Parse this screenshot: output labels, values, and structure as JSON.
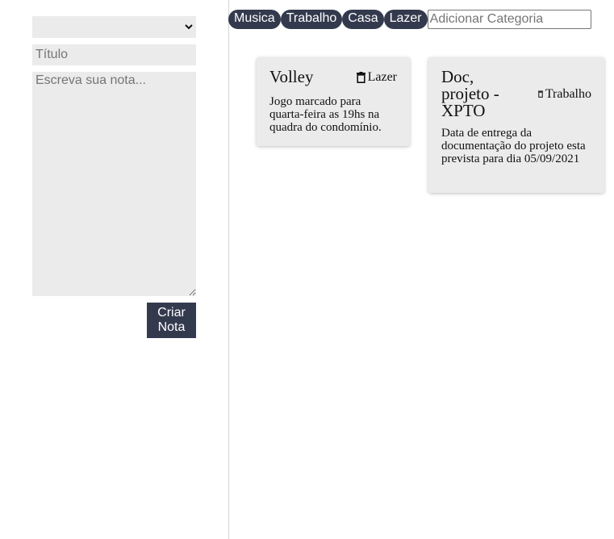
{
  "form": {
    "category_select_value": "",
    "title_placeholder": "Título",
    "note_placeholder": "Escreva sua nota...",
    "create_button_label": "Criar\nNota"
  },
  "categories": {
    "items": [
      "Musica",
      "Trabalho",
      "Casa",
      "Lazer"
    ],
    "add_placeholder": "Adicionar Categoria"
  },
  "notes": [
    {
      "title": "Volley",
      "category": "Lazer",
      "body": "Jogo marcado para quarta-feira as 19hs na quadra do condomínio."
    },
    {
      "title": "Doc, projeto - XPTO",
      "category": "Trabalho",
      "body": "Data de entrega da documentação do projeto esta prevista para dia 05/09/2021"
    }
  ],
  "colors": {
    "accent": "#343a4e",
    "field_background": "#ebebeb",
    "card_background": "#ebebeb"
  },
  "icons": {
    "delete": "trash-icon",
    "select": "chevron-down-icon"
  }
}
